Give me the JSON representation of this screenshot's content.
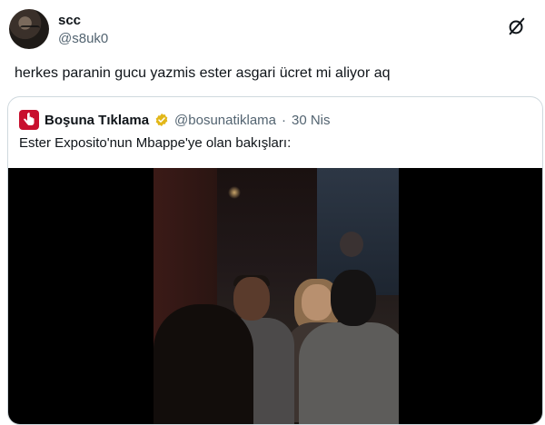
{
  "author": {
    "name": "scc",
    "handle": "@s8uk0"
  },
  "tweet": {
    "text": "herkes paranin gucu yazmis ester asgari ücret mi aliyor aq"
  },
  "quoted": {
    "name": "Boşuna Tıklama",
    "handle": "@bosunatiklama",
    "separator": "·",
    "date": "30 Nis",
    "text": "Ester Exposito'nun Mbappe'ye olan bakışları:"
  },
  "colors": {
    "brand_red": "#c8102e",
    "verified_gold": "#e2b719",
    "secondary_text": "#536471",
    "border": "#cfd9de"
  },
  "icons": {
    "app": "grok-icon",
    "verified": "verified-badge-icon",
    "quoted_avatar": "cursor-hand-icon"
  }
}
